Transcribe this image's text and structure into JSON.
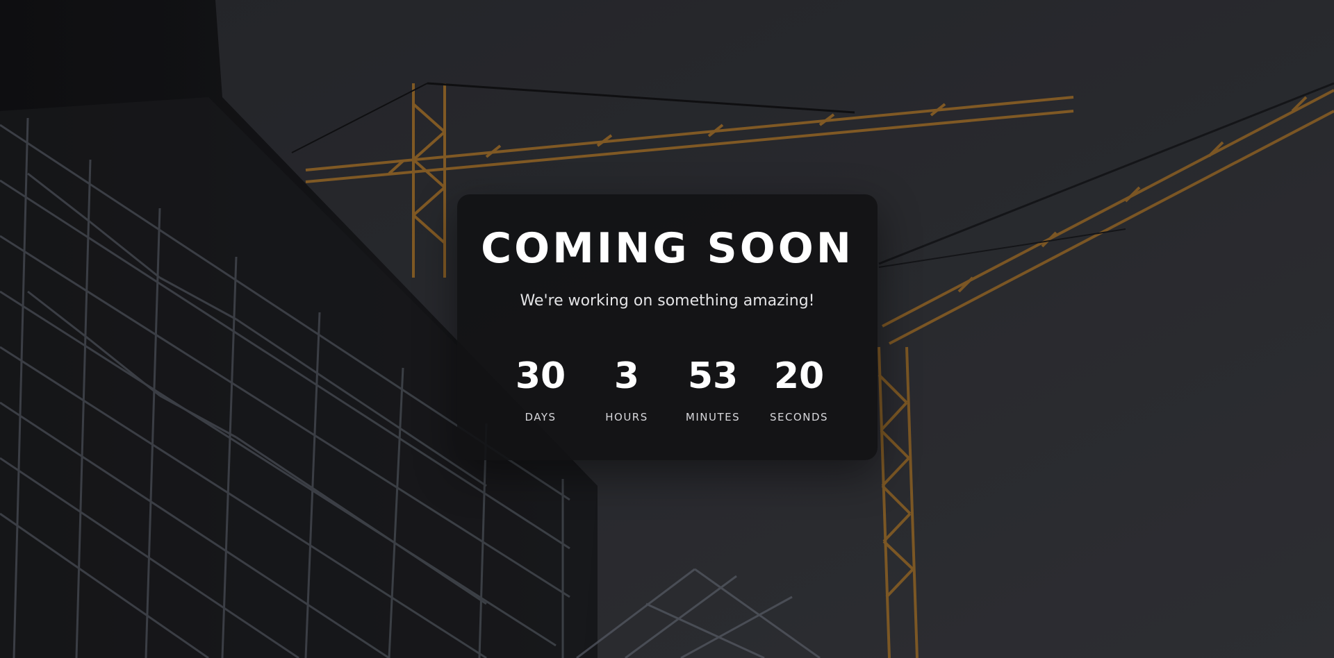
{
  "hero": {
    "title": "COMING SOON",
    "subtitle": "We're working on something amazing!"
  },
  "countdown": [
    {
      "value": "30",
      "label": "DAYS"
    },
    {
      "value": "3",
      "label": "HOURS"
    },
    {
      "value": "53",
      "label": "MINUTES"
    },
    {
      "value": "20",
      "label": "SECONDS"
    }
  ],
  "background": {
    "description_icon": "construction-site-photo",
    "colors": {
      "sky": "#34363c",
      "crane": "#c9872a",
      "building": "#111214",
      "scaffold": "#6e7480"
    }
  }
}
